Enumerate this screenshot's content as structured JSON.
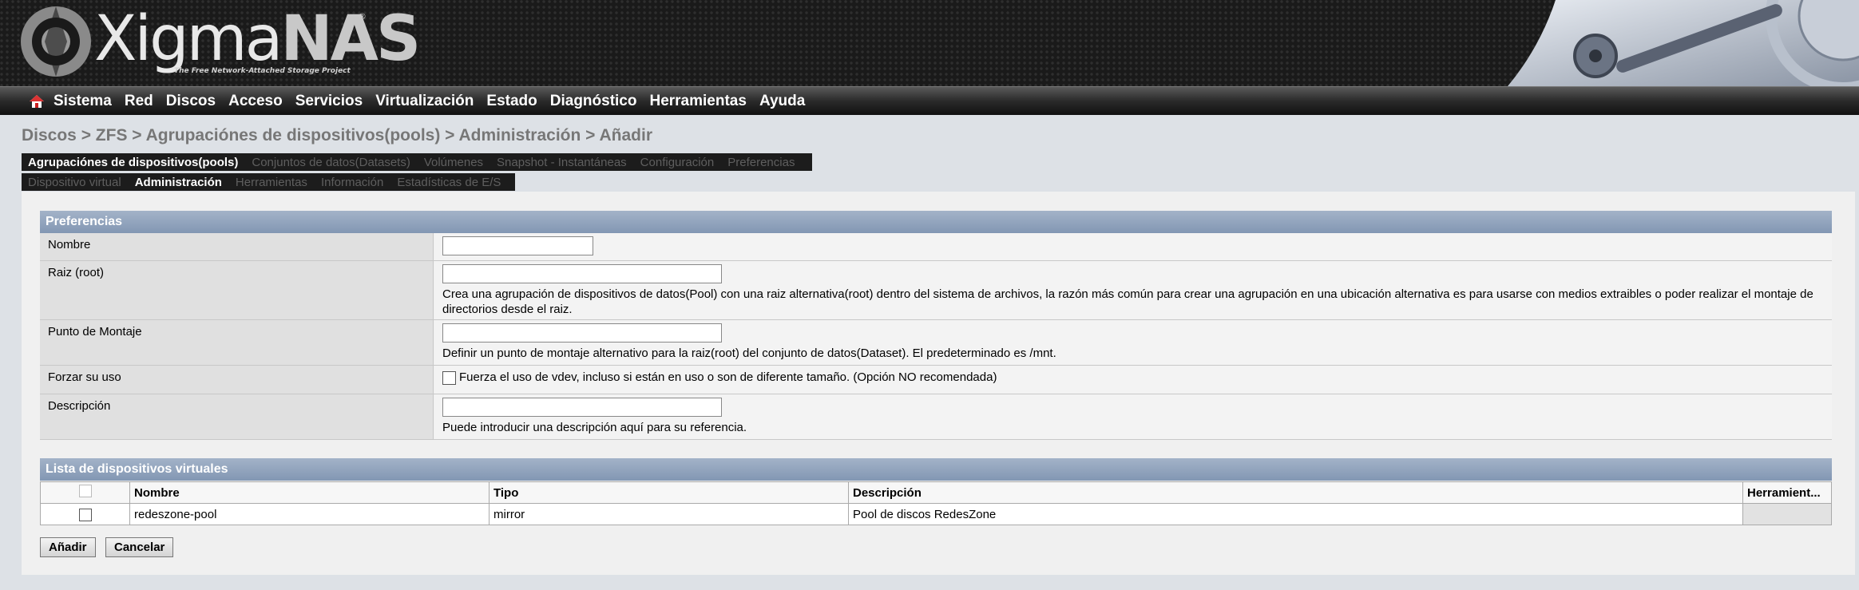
{
  "header": {
    "logo_main": "Xigma",
    "logo_accent": "NAS",
    "logo_reg": "®",
    "tagline": "The Free Network-Attached Storage Project"
  },
  "nav": {
    "items": [
      "Sistema",
      "Red",
      "Discos",
      "Acceso",
      "Servicios",
      "Virtualización",
      "Estado",
      "Diagnóstico",
      "Herramientas",
      "Ayuda"
    ]
  },
  "breadcrumb": "Discos > ZFS > Agrupaciónes de dispositivos(pools) > Administración > Añadir",
  "tabs_primary": [
    {
      "label": "Agrupaciónes de dispositivos(pools)",
      "active": true
    },
    {
      "label": "Conjuntos de datos(Datasets)",
      "active": false
    },
    {
      "label": "Volúmenes",
      "active": false
    },
    {
      "label": "Snapshot - Instantáneas",
      "active": false
    },
    {
      "label": "Configuración",
      "active": false
    },
    {
      "label": "Preferencias",
      "active": false
    }
  ],
  "tabs_secondary": [
    {
      "label": "Dispositivo virtual",
      "active": false
    },
    {
      "label": "Administración",
      "active": true
    },
    {
      "label": "Herramientas",
      "active": false
    },
    {
      "label": "Información",
      "active": false
    },
    {
      "label": "Estadísticas de E/S",
      "active": false
    }
  ],
  "preferences": {
    "title": "Preferencias",
    "name_label": "Nombre",
    "name_value": "",
    "root_label": "Raiz (root)",
    "root_value": "",
    "root_desc": "Crea una agrupación de dispositivos de datos(Pool) con una raiz alternativa(root) dentro del sistema de archivos, la razón más común para crear una agrupación en una ubicación alternativa es para usarse con medios extraibles o poder realizar el montaje de directorios desde el raiz.",
    "mount_label": "Punto de Montaje",
    "mount_value": "",
    "mount_desc": "Definir un punto de montaje alternativo para la raiz(root) del conjunto de datos(Dataset). El predeterminado es /mnt.",
    "force_label": "Forzar su uso",
    "force_desc": "Fuerza el uso de vdev, incluso si están en uso o son de diferente tamaño. (Opción NO recomendada)",
    "force_checked": false,
    "desc_label": "Descripción",
    "desc_value": "",
    "desc_desc": "Puede introducir una descripción aquí para su referencia."
  },
  "vdev_list": {
    "title": "Lista de dispositivos virtuales",
    "columns": [
      "Nombre",
      "Tipo",
      "Descripción",
      "Herramient..."
    ],
    "rows": [
      {
        "name": "redeszone-pool",
        "type": "mirror",
        "description": "Pool de discos RedesZone"
      }
    ]
  },
  "buttons": {
    "add": "Añadir",
    "cancel": "Cancelar"
  }
}
